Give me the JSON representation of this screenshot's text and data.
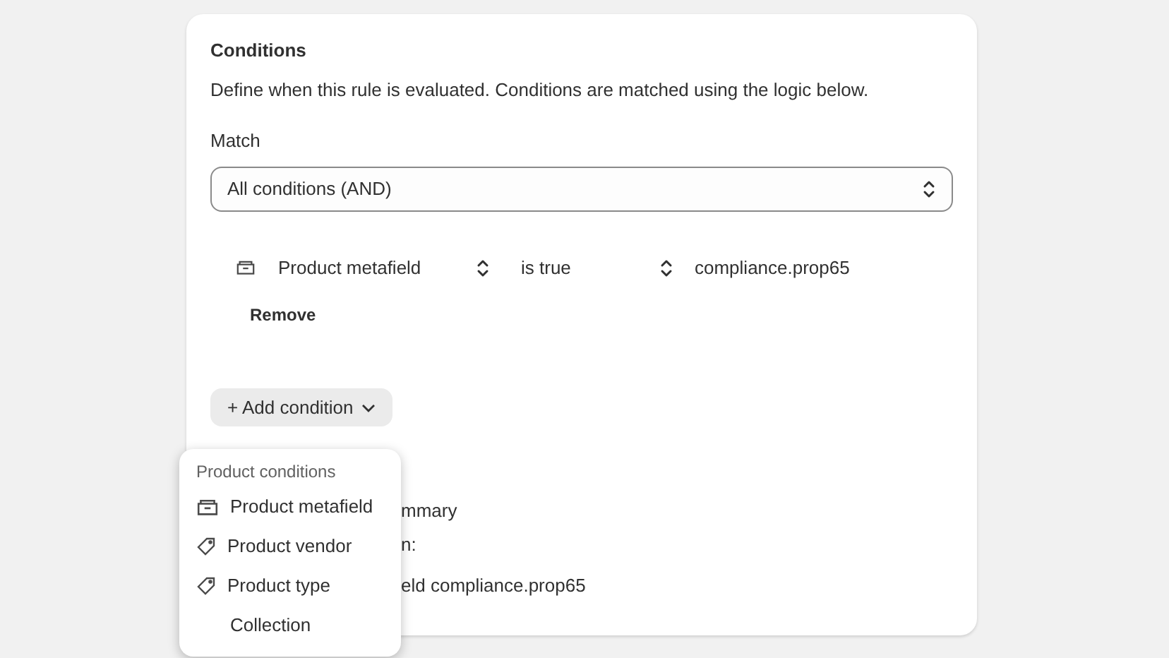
{
  "card": {
    "title": "Conditions",
    "description": "Define when this rule is evaluated. Conditions are matched using the logic below.",
    "match_label": "Match",
    "match_select": {
      "value": "All conditions (AND)"
    },
    "conditions": [
      {
        "field": "Product metafield",
        "operator": "is true",
        "value": "compliance.prop65",
        "remove": "Remove"
      }
    ],
    "add_button": "+ Add condition",
    "summary_fragments": [
      "mmary",
      "n:",
      "eld compliance.prop65"
    ]
  },
  "menu": {
    "heading": "Product conditions",
    "items": [
      {
        "label": "Product metafield",
        "kind": "metafield"
      },
      {
        "label": "Product vendor",
        "kind": "tag"
      },
      {
        "label": "Product type",
        "kind": "tag"
      },
      {
        "label": "Collection",
        "kind": "plain"
      }
    ]
  }
}
